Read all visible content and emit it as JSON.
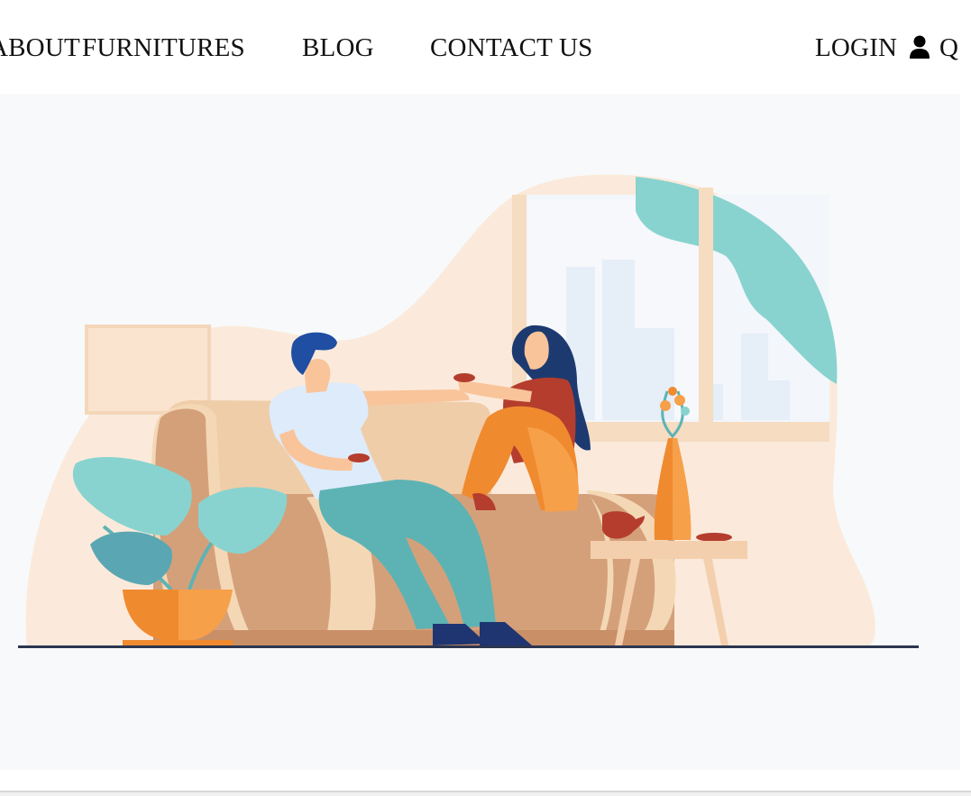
{
  "nav": {
    "items": [
      {
        "label": "ABOUT"
      },
      {
        "label": "FURNITURES"
      },
      {
        "label": "BLOG"
      },
      {
        "label": "CONTACT US"
      }
    ],
    "login_label": "LOGIN",
    "user_icon": "user-icon",
    "search_icon": "search-icon",
    "search_glyph": "Q"
  },
  "hero": {
    "illustration": "couple-on-sofa-illustration",
    "colors": {
      "background": "#f8f9fa",
      "blob": "#fbeadb",
      "sofa": "#d4a07a",
      "teal": "#88d3cf",
      "orange": "#f08a2f",
      "navy": "#1f3b7a",
      "floor": "#2c3650"
    }
  }
}
